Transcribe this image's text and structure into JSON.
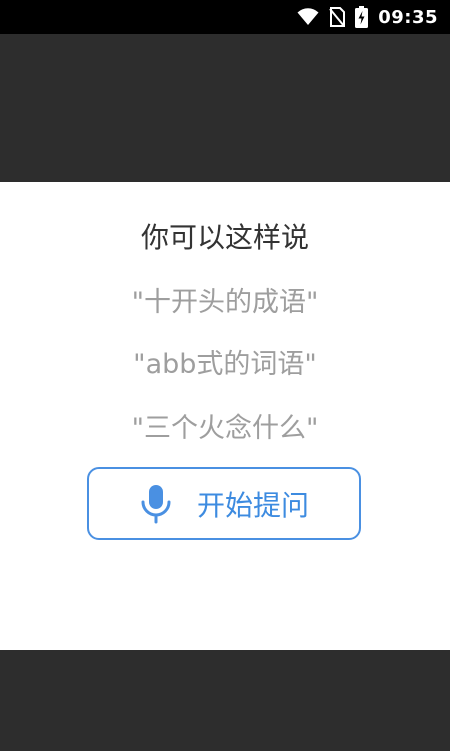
{
  "status_bar": {
    "time": "09:35",
    "icons": [
      "wifi-icon",
      "no-sim-icon",
      "battery-charging-icon"
    ]
  },
  "sheet": {
    "title": "你可以这样说",
    "examples": [
      "\"十开头的成语\"",
      "\"abb式的词语\"",
      "\"三个火念什么\""
    ],
    "ask_button": {
      "icon": "microphone-icon",
      "label": "开始提问"
    }
  },
  "colors": {
    "accent": "#4a90e2",
    "backdrop": "#2d2d2d",
    "example_text": "#9e9e9e"
  }
}
